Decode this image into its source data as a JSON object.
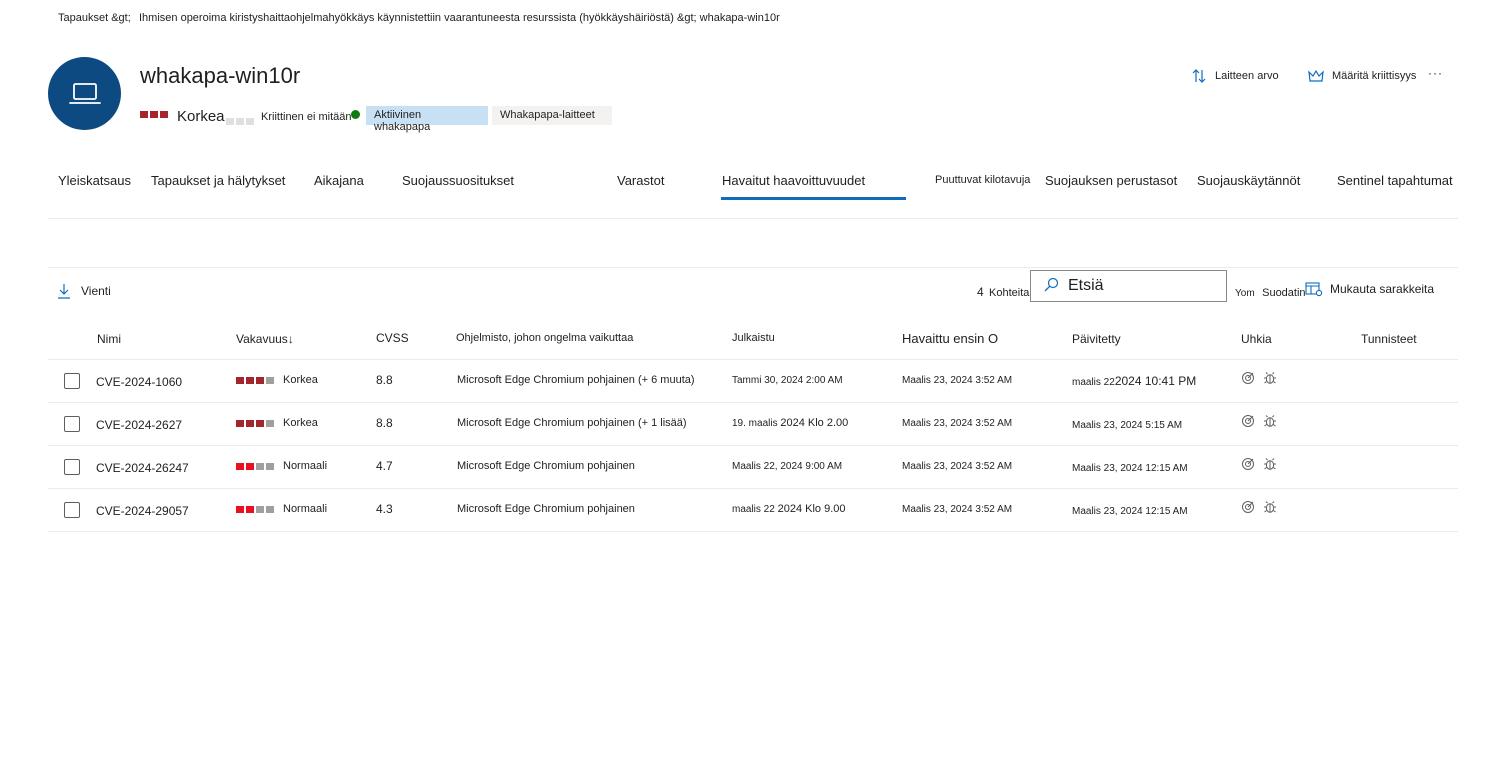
{
  "breadcrumb": {
    "part1": "Tapaukset &gt;",
    "part2": "Ihmisen operoima kiristyshaittaohjelmahyökkäys käynnistettiin vaarantuneesta resurssista (hyökkäyshäiriöstä) &gt; whakapa-win10r"
  },
  "device": {
    "name": "whakapa-win10r",
    "risk_label": "Korkea",
    "criticality_label": "Kriittinen ei mitään",
    "tag_active": "Aktiivinen whakapapa",
    "tag_group": "Whakapapa-laitteet"
  },
  "actions": {
    "device_value": "Laitteen arvo",
    "set_criticality": "Määritä kriittisyys",
    "more": "···"
  },
  "tabs": [
    {
      "label": "Yleiskatsaus"
    },
    {
      "label": "Tapaukset ja hälytykset"
    },
    {
      "label": "Aikajana"
    },
    {
      "label": "Suojaussuositukset"
    },
    {
      "label": "Varastot"
    },
    {
      "label": "Havaitut haavoittuvuudet"
    },
    {
      "label": "Puuttuvat kilotavuja"
    },
    {
      "label": "Suojauksen perustasot"
    },
    {
      "label": "Suojauskäytännöt"
    },
    {
      "label": "Sentinel tapahtumat"
    }
  ],
  "toolbar": {
    "export": "Vienti",
    "count_number": "4",
    "count_label": "Kohteita",
    "search_placeholder": "Etsiä",
    "filter_prefix": "Yom",
    "filter": "Suodatin",
    "customize_columns": "Mukauta sarakkeita"
  },
  "table": {
    "headers": {
      "name": "Nimi",
      "severity": "Vakavuus",
      "severity_sort": "↓",
      "cvss": "CVSS",
      "software": "Ohjelmisto, johon ongelma vaikuttaa",
      "published": "Julkaistu",
      "first_detected": "Havaittu ensin O",
      "updated": "Päivitetty",
      "threats": "Uhkia",
      "tags": "Tunnisteet"
    },
    "rows": [
      {
        "name": "CVE-2024-1060",
        "severity": "Korkea",
        "level": "high",
        "cvss": "8.8",
        "software": "Microsoft Edge Chromium pohjainen (+ 6 muuta)",
        "published_a": "Tammi 30, 2024 2:00 AM",
        "published_b": "",
        "first_detected": "Maalis 23, 2024 3:52 AM",
        "updated_a": "maalis 22",
        "updated_b": "2024 10:41 PM"
      },
      {
        "name": "CVE-2024-2627",
        "severity": "Korkea",
        "level": "high",
        "cvss": "8.8",
        "software": "Microsoft Edge Chromium pohjainen (+ 1 lisää)",
        "published_a": "19. maalis",
        "published_b": "2024  Klo 2.00",
        "first_detected": "Maalis 23, 2024 3:52 AM",
        "updated_a": "Maalis 23, 2024 5:15 AM",
        "updated_b": ""
      },
      {
        "name": "CVE-2024-26247",
        "severity": "Normaali",
        "level": "normal",
        "cvss": "4.7",
        "software": "Microsoft Edge Chromium pohjainen",
        "published_a": "Maalis 22, 2024 9:00 AM",
        "published_b": "",
        "first_detected": "Maalis 23, 2024 3:52 AM",
        "updated_a": "Maalis 23, 2024 12:15 AM",
        "updated_b": ""
      },
      {
        "name": "CVE-2024-29057",
        "severity": "Normaali",
        "level": "normal",
        "cvss": "4.3",
        "software": "Microsoft Edge Chromium pohjainen",
        "published_a": "maalis 22",
        "published_b": "2024  Klo 9.00",
        "first_detected": "Maalis 23, 2024 3:52 AM",
        "updated_a": "Maalis 23, 2024 12:15 AM",
        "updated_b": ""
      }
    ]
  },
  "colors": {
    "accent": "#0f6cbd",
    "avatar_bg": "#0e4a82",
    "sev_high": "#a4262c",
    "sev_normal": "#e81123",
    "sev_empty": "#a19f9d",
    "status_green": "#107c10",
    "tag_active_bg": "#c7e0f4",
    "tag_group_bg": "#f3f2f1"
  }
}
